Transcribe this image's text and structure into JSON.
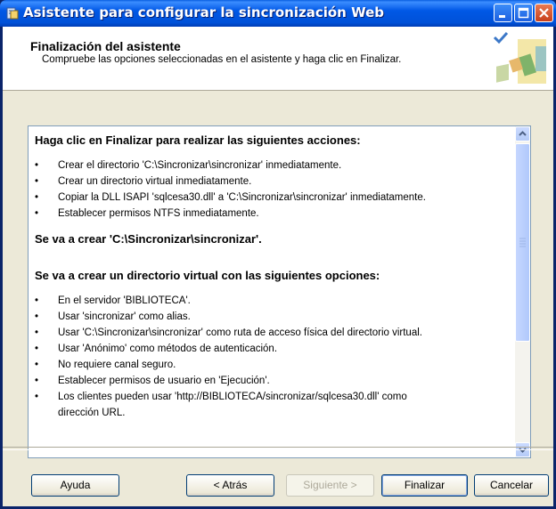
{
  "window": {
    "title": "Asistente para configurar la sincronización Web"
  },
  "header": {
    "title": "Finalización del asistente",
    "subtitle": "Compruebe las opciones seleccionadas en el asistente y haga clic en Finalizar."
  },
  "summary": {
    "heading1": "Haga clic en Finalizar para realizar las siguientes acciones:",
    "actions": [
      "Crear el directorio 'C:\\Sincronizar\\sincronizar' inmediatamente.",
      "Crear un directorio virtual inmediatamente.",
      "Copiar la DLL ISAPI 'sqlcesa30.dll' a 'C:\\Sincronizar\\sincronizar' inmediatamente.",
      "Establecer permisos NTFS inmediatamente."
    ],
    "heading2": "Se va a crear 'C:\\Sincronizar\\sincronizar'.",
    "heading3": "Se va a crear un directorio virtual con las siguientes opciones:",
    "options": [
      "En el servidor 'BIBLIOTECA'.",
      "Usar 'sincronizar' como alias.",
      "Usar 'C:\\Sincronizar\\sincronizar' como ruta de acceso física del directorio virtual.",
      "Usar 'Anónimo' como métodos de autenticación.",
      "No requiere canal seguro.",
      "Establecer permisos de usuario en 'Ejecución'.",
      "Los clientes pueden usar 'http://BIBLIOTECA/sincronizar/sqlcesa30.dll' como"
    ],
    "partial_line": "dirección URL."
  },
  "buttons": {
    "help": "Ayuda",
    "back": "< Atrás",
    "next": "Siguiente >",
    "finish": "Finalizar",
    "cancel": "Cancelar"
  }
}
